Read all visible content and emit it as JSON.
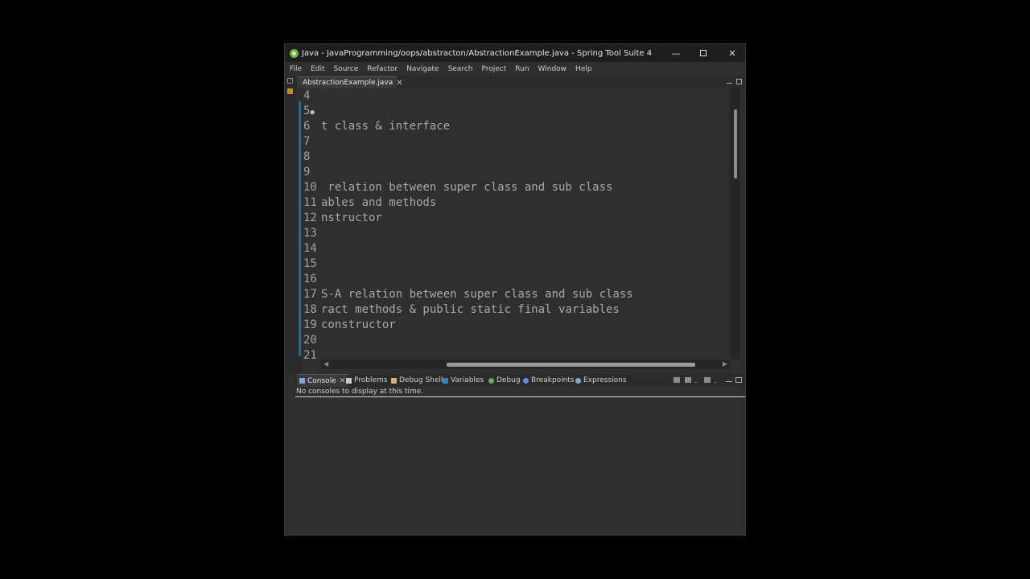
{
  "window": {
    "title": "Java - JavaProgramming/oops/abstracton/AbstractionExample.java - Spring Tool Suite 4",
    "minimize_glyph": "—",
    "close_glyph": "✕"
  },
  "menu": [
    "File",
    "Edit",
    "Source",
    "Refactor",
    "Navigate",
    "Search",
    "Project",
    "Run",
    "Window",
    "Help"
  ],
  "editor": {
    "tab_label": "AbstractionExample.java",
    "tab_close": "✕",
    "lines": [
      {
        "num": "4",
        "text": ""
      },
      {
        "num": "5",
        "text": ""
      },
      {
        "num": "6",
        "text": "t class & interface"
      },
      {
        "num": "7",
        "text": ""
      },
      {
        "num": "8",
        "text": ""
      },
      {
        "num": "9",
        "text": ""
      },
      {
        "num": "10",
        "text": " relation between super class and sub class"
      },
      {
        "num": "11",
        "text": "ables and methods"
      },
      {
        "num": "12",
        "text": "nstructor"
      },
      {
        "num": "13",
        "text": ""
      },
      {
        "num": "14",
        "text": ""
      },
      {
        "num": "15",
        "text": ""
      },
      {
        "num": "16",
        "text": ""
      },
      {
        "num": "17",
        "text": "S-A relation between super class and sub class"
      },
      {
        "num": "18",
        "text": "ract methods & public static final variables"
      },
      {
        "num": "19",
        "text": "constructor"
      },
      {
        "num": "20",
        "text": ""
      },
      {
        "num": "21",
        "text": ""
      }
    ],
    "fold_marker": "●",
    "scroll_left": "◀",
    "scroll_right": "▶"
  },
  "bottom_panel": {
    "tabs": {
      "console": "Console",
      "console_close": "✕",
      "problems": "Problems",
      "debug_shell": "Debug Shell",
      "variables": "Variables",
      "debug": "Debug",
      "breakpoints": "Breakpoints",
      "expressions": "Expressions"
    },
    "console_message": "No consoles to display at this time."
  },
  "colors": {
    "title_bar": "#1e1e1e",
    "background": "#2f2f2f",
    "change_bar": "#2b6a8f",
    "spring_green": "#6db33f"
  }
}
